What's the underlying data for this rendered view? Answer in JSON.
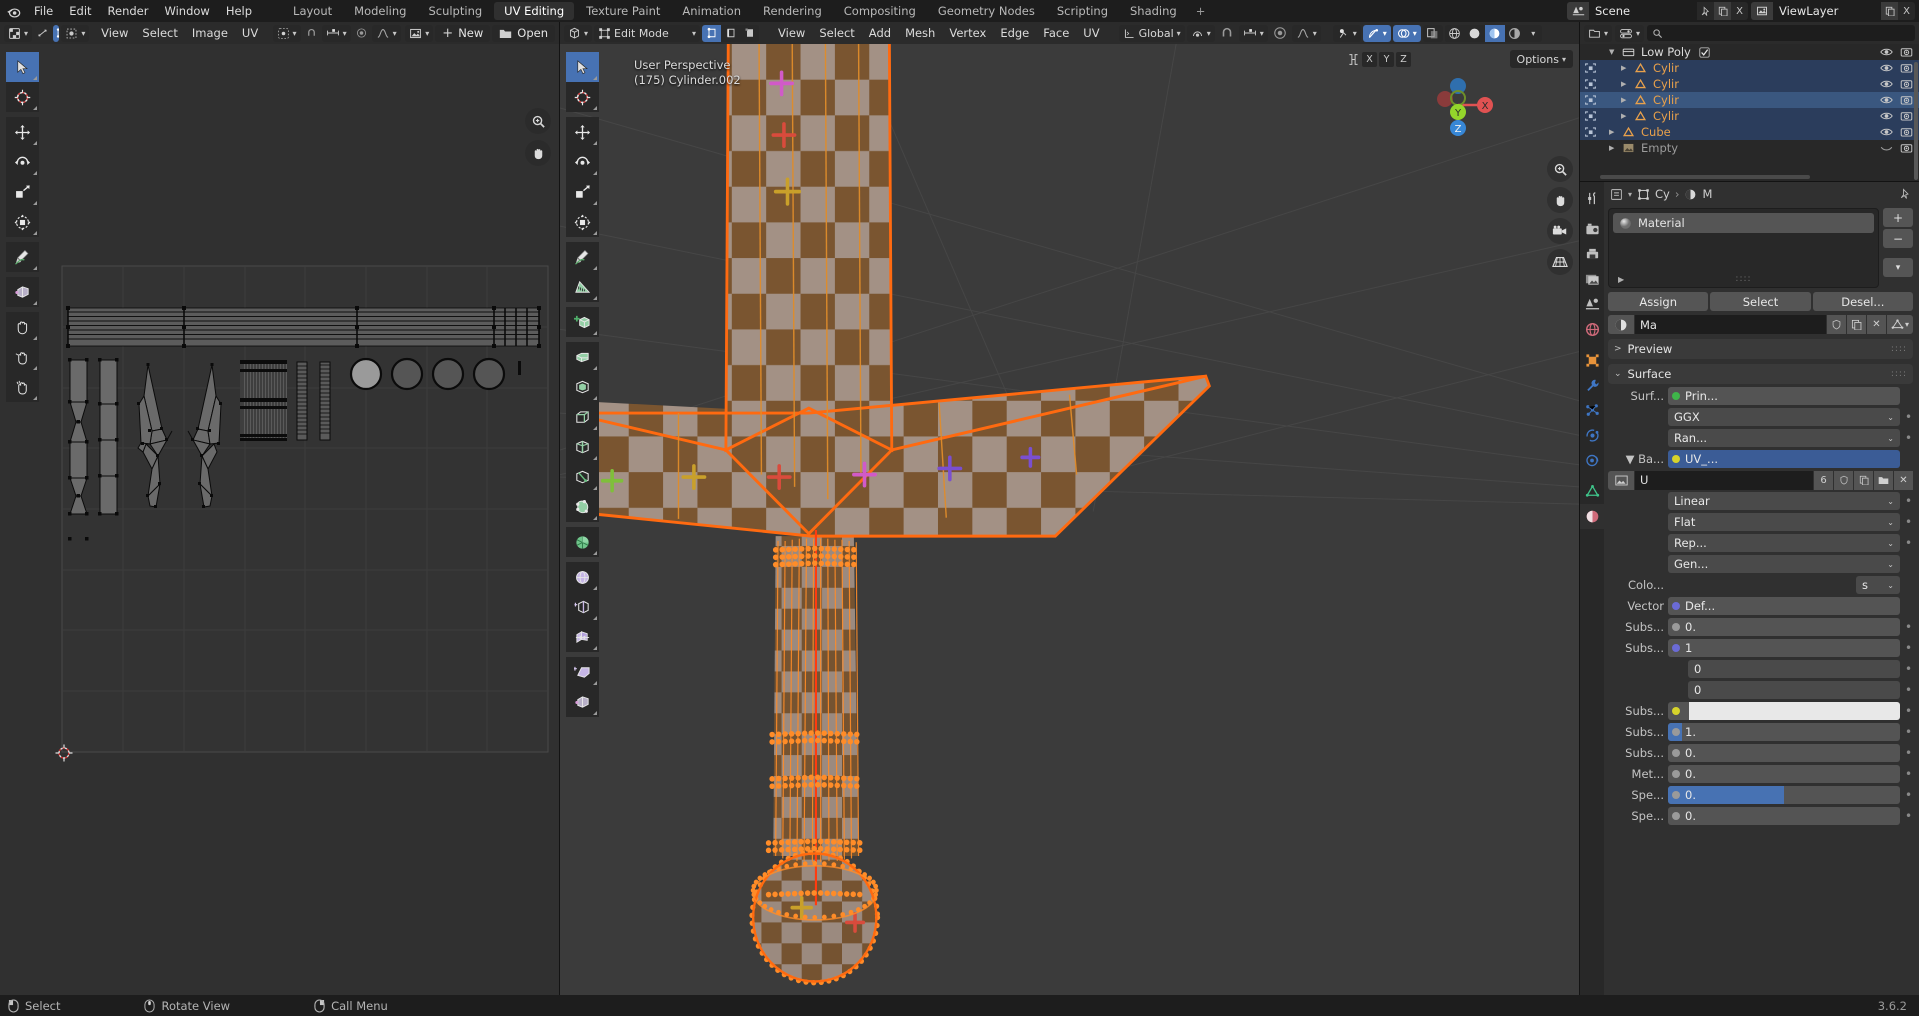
{
  "app": {
    "name": "Blender",
    "version": "3.6.2"
  },
  "topbar": {
    "logo_icon": "blender-logo-icon",
    "menus": [
      "File",
      "Edit",
      "Render",
      "Window",
      "Help"
    ],
    "workspaces": [
      {
        "label": "Layout",
        "active": false
      },
      {
        "label": "Modeling",
        "active": false
      },
      {
        "label": "Sculpting",
        "active": false
      },
      {
        "label": "UV Editing",
        "active": true
      },
      {
        "label": "Texture Paint",
        "active": false
      },
      {
        "label": "Animation",
        "active": false
      },
      {
        "label": "Rendering",
        "active": false
      },
      {
        "label": "Compositing",
        "active": false
      },
      {
        "label": "Geometry Nodes",
        "active": false
      },
      {
        "label": "Scripting",
        "active": false
      },
      {
        "label": "Shading",
        "active": false
      }
    ],
    "add_workspace_label": "+",
    "scene": {
      "icon": "scene-icon",
      "name": "Scene",
      "pin_icon": "pin-icon",
      "copy_icon": "duplicate-icon",
      "close_label": "X"
    },
    "viewlayer": {
      "icon": "viewlayer-icon",
      "name": "ViewLayer",
      "copy_icon": "duplicate-icon",
      "close_label": "X"
    }
  },
  "uv_editor": {
    "header": {
      "editor_type_icon": "uv-editor-icon",
      "sync_icon": "uv-sync-icon",
      "select_modes": [
        "vertex-select-icon",
        "edge-select-icon",
        "face-select-icon",
        "island-select-icon"
      ],
      "active_select_mode": 0,
      "sticky_icon": "sticky-selection-icon",
      "menus": [
        "View",
        "Select",
        "Image",
        "UV"
      ],
      "pivot_icon": "pivot-point-icon",
      "snap_icon": "snap-magnet-icon",
      "snap_target_icon": "snap-target-icon",
      "proportional_icon": "proportional-edit-icon",
      "falloff_icon": "proportional-falloff-icon",
      "image_icon": "image-datablock-icon",
      "new_label": "New",
      "open_label": "Open"
    },
    "toolbar": [
      {
        "name": "tweak-tool",
        "icon": "cursor-arrow-icon",
        "active": true
      },
      {
        "name": "cursor-tool",
        "icon": "3d-cursor-icon",
        "active": false
      },
      {
        "name": "move-tool",
        "icon": "move-arrows-icon",
        "active": false
      },
      {
        "name": "rotate-tool",
        "icon": "rotate-icon",
        "active": false
      },
      {
        "name": "scale-tool",
        "icon": "scale-icon",
        "active": false
      },
      {
        "name": "transform-tool",
        "icon": "transform-icon",
        "active": false
      },
      {
        "name": "annotate-tool",
        "icon": "pencil-icon",
        "active": false
      },
      {
        "name": "rip-region-tool",
        "icon": "rip-region-icon",
        "active": false
      },
      {
        "name": "grab-tool",
        "icon": "hand-icon",
        "active": false
      },
      {
        "name": "relax-tool",
        "icon": "relax-hand-icon",
        "active": false
      },
      {
        "name": "pinch-tool",
        "icon": "pinch-hand-icon",
        "active": false
      }
    ],
    "nav": [
      {
        "name": "zoom-nav",
        "icon": "zoom-icon"
      },
      {
        "name": "pan-nav",
        "icon": "hand-icon"
      }
    ],
    "canvas": {
      "cursor_icon": "2d-cursor-icon",
      "uv_island_groups": [
        "blade-strips",
        "edge-bevels",
        "guard-wings",
        "grip-wraps",
        "pommel-rings",
        "pommel-caps"
      ]
    }
  },
  "viewport": {
    "header": {
      "editor_type_icon": "3d-viewport-icon",
      "mode_icon": "edit-mode-icon",
      "mode_label": "Edit Mode",
      "mesh_select_modes": [
        "vertex-select-icon",
        "edge-select-icon",
        "face-select-icon"
      ],
      "active_mesh_mode": 0,
      "menus": [
        "View",
        "Select",
        "Add",
        "Mesh",
        "Vertex",
        "Edge",
        "Face",
        "UV"
      ],
      "orientation_icon": "transform-orientation-icon",
      "orientation_label": "Global",
      "pivot_icon": "pivot-point-icon",
      "snap_icon": "snap-magnet-icon",
      "snap_target_icon": "snap-target-icon",
      "proportional_icon": "proportional-edit-icon",
      "falloff_icon": "proportional-falloff-icon",
      "mesh_edit_overlay_icon": "mesh-edit-mode-overlay-icon",
      "gizmo_icon": "gizmo-icon",
      "overlays_icon": "overlays-icon",
      "xray_icon": "xray-toggle-icon",
      "shading_modes": [
        "wireframe-shading-icon",
        "solid-shading-icon",
        "material-preview-shading-icon",
        "rendered-shading-icon"
      ],
      "active_shading": 2
    },
    "overlay_text": {
      "perspective": "User Perspective",
      "object_info": "(175) Cylinder.002"
    },
    "axis_locks": [
      "X",
      "Y",
      "Z"
    ],
    "options_label": "Options",
    "gizmo_axes": [
      {
        "label": "X",
        "color": "#e05252",
        "filled": true
      },
      {
        "label": "Y",
        "color": "#94d62b",
        "filled": true
      },
      {
        "label": "Z",
        "color": "#3787d6",
        "filled": true
      }
    ],
    "toolbar": [
      {
        "name": "tweak-tool",
        "icon": "cursor-arrow-icon",
        "active": true
      },
      {
        "name": "cursor-tool",
        "icon": "3d-cursor-icon",
        "active": false
      },
      {
        "name": "move-tool",
        "icon": "move-arrows-icon",
        "active": false
      },
      {
        "name": "rotate-tool",
        "icon": "rotate-icon",
        "active": false
      },
      {
        "name": "scale-tool",
        "icon": "scale-icon",
        "active": false
      },
      {
        "name": "transform-tool",
        "icon": "transform-icon",
        "active": false
      },
      {
        "name": "annotate-tool",
        "icon": "pencil-icon",
        "active": false
      },
      {
        "name": "measure-tool",
        "icon": "ruler-icon",
        "active": false
      },
      {
        "name": "add-cube-tool",
        "icon": "add-cube-icon",
        "active": false
      },
      {
        "name": "extrude-region-tool",
        "icon": "extrude-region-icon",
        "active": false
      },
      {
        "name": "inset-faces-tool",
        "icon": "inset-faces-icon",
        "active": false
      },
      {
        "name": "bevel-tool",
        "icon": "bevel-icon",
        "active": false
      },
      {
        "name": "loop-cut-tool",
        "icon": "loop-cut-icon",
        "active": false
      },
      {
        "name": "knife-tool",
        "icon": "knife-icon",
        "active": false
      },
      {
        "name": "poly-build-tool",
        "icon": "poly-build-icon",
        "active": false
      },
      {
        "name": "spin-tool",
        "icon": "spin-icon",
        "active": false
      },
      {
        "name": "smooth-tool",
        "icon": "smooth-icon",
        "active": false
      },
      {
        "name": "edge-slide-tool",
        "icon": "edge-slide-icon",
        "active": false
      },
      {
        "name": "shrink-fatten-tool",
        "icon": "shrink-fatten-icon",
        "active": false
      },
      {
        "name": "shear-tool",
        "icon": "shear-icon",
        "active": false
      },
      {
        "name": "rip-region-tool",
        "icon": "rip-region-icon",
        "active": false
      }
    ],
    "nav": [
      {
        "name": "zoom-nav",
        "icon": "zoom-icon"
      },
      {
        "name": "pan-nav",
        "icon": "hand-icon"
      },
      {
        "name": "camera-nav",
        "icon": "camera-icon"
      },
      {
        "name": "ortho-persp-nav",
        "icon": "grid-perspective-icon"
      }
    ]
  },
  "outliner": {
    "header": {
      "display_mode_icon": "outliner-display-mode-icon",
      "filter_icon": "filter-icon",
      "search_icon": "search-icon",
      "search_value": "",
      "search_placeholder": ""
    },
    "rows": [
      {
        "label": "Low Poly",
        "type": "collection",
        "icon": "collection-icon",
        "checkbox": true,
        "indent": 0,
        "state": "none",
        "name_class": "white",
        "eye": "eye-open-icon",
        "render": "camera-on-icon",
        "expander": "down"
      },
      {
        "label": "Cylir",
        "type": "mesh",
        "icon": "mesh-data-icon",
        "indent": 1,
        "state": "selected",
        "name_class": "orange",
        "eye": "eye-open-icon",
        "render": "camera-on-icon",
        "expander": "right"
      },
      {
        "label": "Cylir",
        "type": "mesh",
        "icon": "mesh-data-icon",
        "indent": 1,
        "state": "selected",
        "name_class": "orange",
        "eye": "eye-open-icon",
        "render": "camera-on-icon",
        "expander": "right"
      },
      {
        "label": "Cylir",
        "type": "mesh",
        "icon": "mesh-data-icon",
        "indent": 1,
        "state": "active",
        "name_class": "orange",
        "eye": "eye-open-icon",
        "render": "camera-on-icon",
        "expander": "right"
      },
      {
        "label": "Cylir",
        "type": "mesh",
        "icon": "mesh-data-icon",
        "indent": 1,
        "state": "selected",
        "name_class": "orange",
        "eye": "eye-open-icon",
        "render": "camera-on-icon",
        "expander": "right"
      },
      {
        "label": "Cube",
        "type": "mesh",
        "icon": "mesh-data-icon",
        "indent": 0,
        "state": "selected",
        "name_class": "orange",
        "eye": "eye-open-icon",
        "render": "camera-on-icon",
        "expander": "right"
      },
      {
        "label": "Empty",
        "type": "image-empty",
        "icon": "image-empty-icon",
        "indent": 0,
        "state": "none",
        "name_class": "dim",
        "eye": "eye-closed-icon",
        "render": "camera-on-icon",
        "expander": "right"
      }
    ]
  },
  "properties": {
    "tabs": [
      {
        "name": "tool-tab",
        "icon": "tool-wrench-screwdriver-icon",
        "active": false
      },
      {
        "name": "render-tab",
        "icon": "render-camera-back-icon",
        "active": false
      },
      {
        "name": "output-tab",
        "icon": "output-printer-icon",
        "active": false
      },
      {
        "name": "viewlayer-tab",
        "icon": "view-layer-images-icon",
        "active": false
      },
      {
        "name": "scene-tab",
        "icon": "scene-cone-icon",
        "active": false
      },
      {
        "name": "world-tab",
        "icon": "world-globe-icon",
        "active": false
      },
      {
        "name": "object-tab",
        "icon": "object-square-icon",
        "active": false
      },
      {
        "name": "modifier-tab",
        "icon": "modifier-wrench-icon",
        "active": false
      },
      {
        "name": "particles-tab",
        "icon": "particles-icon",
        "active": false
      },
      {
        "name": "physics-tab",
        "icon": "physics-orbit-icon",
        "active": false
      },
      {
        "name": "constraints-tab",
        "icon": "constraints-icon",
        "active": false
      },
      {
        "name": "data-tab",
        "icon": "mesh-data-triangle-icon",
        "active": false
      },
      {
        "name": "material-tab",
        "icon": "material-sphere-icon",
        "active": true
      }
    ],
    "breadcrumb": {
      "object_icon": "object-square-icon",
      "object_label": "Cy",
      "sep": "›",
      "material_icon": "material-sphere-icon",
      "material_label": "M",
      "pin_icon": "pin-icon"
    },
    "material_slots": {
      "items": [
        {
          "icon": "material-preview-sphere-icon",
          "name": "Material"
        }
      ],
      "add_label": "+",
      "remove_label": "−",
      "menu_icon": "chevron-down-icon",
      "expand_icon": "triangle-right-icon",
      "grip_icon": "grip-dots-icon"
    },
    "slot_actions": [
      "Assign",
      "Select",
      "Desel..."
    ],
    "material_id": {
      "icon": "material-sphere-icon",
      "name": "Ma",
      "shield_icon": "fake-user-shield-icon",
      "copy_icon": "new-material-icon",
      "close_icon": "unlink-x-icon",
      "data_icon": "mesh-data-triangle-icon"
    },
    "panels": [
      {
        "label": "Preview",
        "open": false,
        "grip": "grip-dots-icon"
      },
      {
        "label": "Surface",
        "open": true,
        "grip": "grip-dots-icon"
      }
    ],
    "surface_rows": [
      {
        "label": "Surf...",
        "value": "Prin...",
        "socket": "#3fb54a",
        "type": "node",
        "dot": false
      },
      {
        "label": "",
        "value": "GGX",
        "type": "enum",
        "dot": true
      },
      {
        "label": "",
        "value": "Ran...",
        "type": "enum",
        "dot": true
      },
      {
        "label": "Ba...",
        "value": "UV_...",
        "socket": "#d6d32b",
        "type": "texture-node",
        "dot": false,
        "expander": "triangle-down-icon",
        "highlight": true
      },
      {
        "label": "",
        "value": "U",
        "count": "6",
        "type": "image-id",
        "icon": "image-datablock-icon",
        "shield_icon": "fake-user-shield-icon",
        "copy_icon": "duplicate-icon",
        "browse_icon": "folder-icon",
        "close_icon": "unlink-x-icon"
      },
      {
        "label": "",
        "value": "Linear",
        "type": "enum",
        "dot": true
      },
      {
        "label": "",
        "value": "Flat",
        "type": "enum",
        "dot": true
      },
      {
        "label": "",
        "value": "Rep...",
        "type": "enum",
        "dot": true
      },
      {
        "label": "",
        "value": "Gen...",
        "type": "enum",
        "dot": false
      },
      {
        "label": "Colo...",
        "value": "s",
        "type": "small-enum",
        "dot": false
      },
      {
        "label": "Vector",
        "value": "Def...",
        "socket": "#6b6bd6",
        "type": "node",
        "dot": false
      },
      {
        "label": "Subs...",
        "value": "0.",
        "socket": "#9a9a9a",
        "type": "value",
        "dot": true
      },
      {
        "label": "Subs...",
        "value": "1",
        "socket": "#6b6bd6",
        "type": "value",
        "dot": true
      },
      {
        "label": "",
        "value": "0",
        "type": "value-sub",
        "dot": true
      },
      {
        "label": "",
        "value": "0",
        "type": "value-sub",
        "dot": true
      },
      {
        "label": "Subs...",
        "value": "",
        "socket": "#d6d32b",
        "type": "color",
        "swatch": "#e8e8e8",
        "dot": true
      },
      {
        "label": "Subs...",
        "value": "1.",
        "socket": "#9a9a9a",
        "type": "slider",
        "fill": 6,
        "dot": true
      },
      {
        "label": "Subs...",
        "value": "0.",
        "socket": "#9a9a9a",
        "type": "value",
        "dot": true
      },
      {
        "label": "Met...",
        "value": "0.",
        "socket": "#9a9a9a",
        "type": "value",
        "dot": true
      },
      {
        "label": "Spe...",
        "value": "0.",
        "socket": "#9a9a9a",
        "type": "slider",
        "fill": 50,
        "dot": true
      },
      {
        "label": "Spe...",
        "value": "0.",
        "socket": "#9a9a9a",
        "type": "value",
        "dot": true
      }
    ]
  },
  "status_bar": {
    "items": [
      {
        "icon": "mouse-left-icon",
        "label": "Select"
      },
      {
        "icon": "mouse-middle-icon",
        "label": "Rotate View"
      },
      {
        "icon": "mouse-right-icon",
        "label": "Call Menu"
      }
    ],
    "version_label": "3.6.2"
  },
  "colors": {
    "accent_blue": "#4772b3",
    "orange_select": "#ff8c28",
    "orange_active": "#ffa040",
    "outliner_orange": "#e9a14b",
    "bg_dark": "#1d1d1d",
    "bg_header": "#2b2b2b",
    "bg_editor": "#303030",
    "bg_viewport": "#3b3b3b"
  }
}
